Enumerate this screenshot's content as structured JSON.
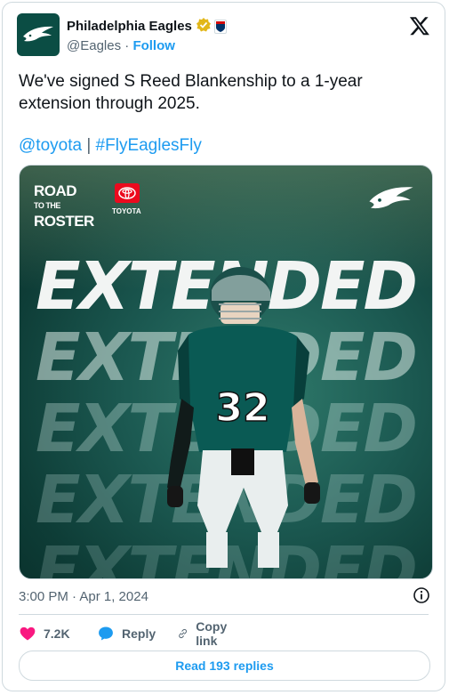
{
  "author": {
    "display_name": "Philadelphia Eagles",
    "handle": "@Eagles",
    "separator": "·",
    "follow_label": "Follow"
  },
  "tweet": {
    "text": "We've signed S Reed Blankenship to a 1-year extension through 2025.",
    "mention": "@toyota",
    "link_separator": " | ",
    "hashtag": "#FlyEaglesFly"
  },
  "media": {
    "headline": "EXTENDED",
    "road_line1": "ROAD",
    "road_line2": "TO THE",
    "road_line3": "ROSTER",
    "sponsor": "TOYOTA",
    "jersey_number": "32"
  },
  "meta": {
    "timestamp": "3:00 PM · Apr 1, 2024"
  },
  "actions": {
    "likes": "7.2K",
    "reply_label": "Reply",
    "copy_link_label": "Copy link"
  },
  "footer": {
    "read_replies_label": "Read 193 replies"
  },
  "colors": {
    "accent": "#1d9bf0",
    "like": "#f91880",
    "eagles_green": "#004c54"
  }
}
